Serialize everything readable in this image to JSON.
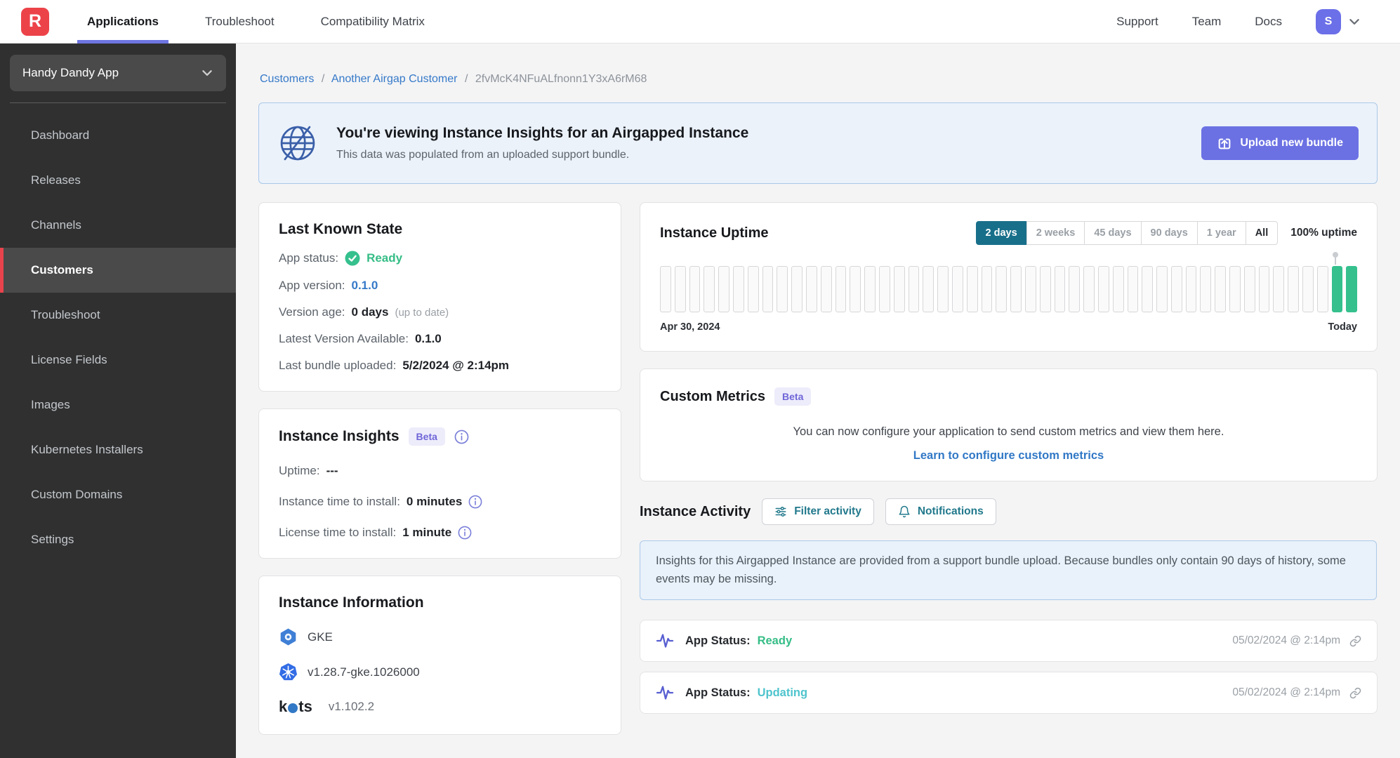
{
  "header": {
    "logo_letter": "R",
    "nav": [
      {
        "label": "Applications",
        "active": true
      },
      {
        "label": "Troubleshoot",
        "active": false
      },
      {
        "label": "Compatibility Matrix",
        "active": false
      }
    ],
    "right_nav": [
      {
        "label": "Support"
      },
      {
        "label": "Team"
      },
      {
        "label": "Docs"
      }
    ],
    "avatar_initial": "S"
  },
  "sidebar": {
    "app_selector": "Handy Dandy App",
    "items": [
      {
        "label": "Dashboard",
        "active": false
      },
      {
        "label": "Releases",
        "active": false
      },
      {
        "label": "Channels",
        "active": false
      },
      {
        "label": "Customers",
        "active": true
      },
      {
        "label": "Troubleshoot",
        "active": false
      },
      {
        "label": "License Fields",
        "active": false
      },
      {
        "label": "Images",
        "active": false
      },
      {
        "label": "Kubernetes Installers",
        "active": false
      },
      {
        "label": "Custom Domains",
        "active": false
      },
      {
        "label": "Settings",
        "active": false
      }
    ]
  },
  "breadcrumb": {
    "links": [
      "Customers",
      "Another Airgap Customer"
    ],
    "current": "2fvMcK4NFuALfnonn1Y3xA6rM68",
    "separator": "/"
  },
  "banner": {
    "title": "You're viewing Instance Insights for an Airgapped Instance",
    "subtitle": "This data was populated from an uploaded support bundle.",
    "button_label": "Upload new bundle"
  },
  "last_known_state": {
    "title": "Last Known State",
    "app_status_label": "App status:",
    "app_status_value": "Ready",
    "app_version_label": "App version:",
    "app_version_value": "0.1.0",
    "version_age_label": "Version age:",
    "version_age_value": "0 days",
    "version_age_note": "(up to date)",
    "latest_version_label": "Latest Version Available:",
    "latest_version_value": "0.1.0",
    "last_bundle_label": "Last bundle uploaded:",
    "last_bundle_value": "5/2/2024 @ 2:14pm"
  },
  "instance_insights": {
    "title": "Instance Insights",
    "badge": "Beta",
    "uptime_label": "Uptime:",
    "uptime_value": "---",
    "instance_time_label": "Instance time to install:",
    "instance_time_value": "0 minutes",
    "license_time_label": "License time to install:",
    "license_time_value": "1 minute"
  },
  "instance_information": {
    "title": "Instance Information",
    "distribution": "GKE",
    "k8s_version": "v1.28.7-gke.1026000",
    "kots_brand_k": "k",
    "kots_brand_ts": "ts",
    "kots_version": "v1.102.2"
  },
  "instance_uptime": {
    "title": "Instance Uptime",
    "ranges": [
      "2 days",
      "2 weeks",
      "45 days",
      "90 days",
      "1 year",
      "All"
    ],
    "active_range": "2 days",
    "summary": "100% uptime",
    "start_label": "Apr 30, 2024",
    "end_label": "Today",
    "bars": {
      "total": 48,
      "green_at_end": 2
    }
  },
  "custom_metrics": {
    "title": "Custom Metrics",
    "badge": "Beta",
    "description": "You can now configure your application to send custom metrics and view them here.",
    "link_label": "Learn to configure custom metrics"
  },
  "instance_activity": {
    "title": "Instance Activity",
    "filter_button": "Filter activity",
    "notifications_button": "Notifications",
    "notice": "Insights for this Airgapped Instance are provided from a support bundle upload. Because bundles only contain 90 days of history, some events may be missing.",
    "events": [
      {
        "label": "App Status:",
        "value": "Ready",
        "value_color": "#35bd86",
        "timestamp": "05/02/2024 @ 2:14pm"
      },
      {
        "label": "App Status:",
        "value": "Updating",
        "value_color": "#4ec4cd",
        "timestamp": "05/02/2024 @ 2:14pm"
      }
    ]
  },
  "colors": {
    "brand_red": "#ec4349",
    "accent_indigo": "#6b71e3",
    "active_range_teal": "#186f8a",
    "success_green": "#35c08e",
    "updating_teal": "#4ec4cd",
    "link_blue": "#3579c8"
  }
}
